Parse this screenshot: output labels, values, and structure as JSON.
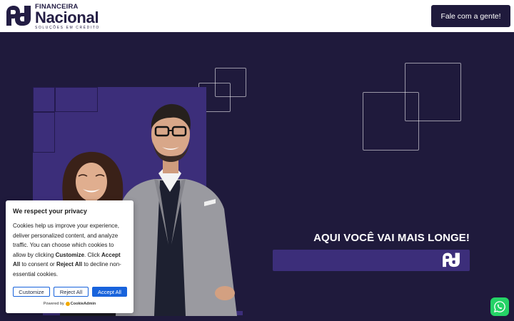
{
  "header": {
    "logo": {
      "top_text": "FINANCEIRA",
      "main_text": "Nacional",
      "sub_text": "SOLUÇÕES EM CRÉDITO"
    },
    "cta_label": "Fale com a gente!"
  },
  "hero": {
    "tagline": "AQUI VOCÊ VAI MAIS LONGE!",
    "image": "two-business-people-photo"
  },
  "cookie_banner": {
    "title": "We respect your privacy",
    "body_1": "Cookies help us improve your experience, deliver personalized content, and analyze traffic. You can choose which cookies to allow by clicking ",
    "customize_word": "Customize",
    "body_2": ". Click ",
    "accept_word": "Accept All",
    "body_3": " to consent or ",
    "reject_word": "Reject All",
    "body_4": " to decline non-essential cookies.",
    "buttons": {
      "customize": "Customize",
      "reject": "Reject All",
      "accept": "Accept All"
    },
    "powered_by": "Powered by",
    "powered_brand": "CookieAdmin"
  },
  "whatsapp": {
    "icon": "whatsapp-icon"
  },
  "colors": {
    "brand_dark": "#1f1a3c",
    "brand_purple": "#3c2e7a",
    "accept_blue": "#1863dc",
    "whatsapp_green": "#25d366"
  }
}
